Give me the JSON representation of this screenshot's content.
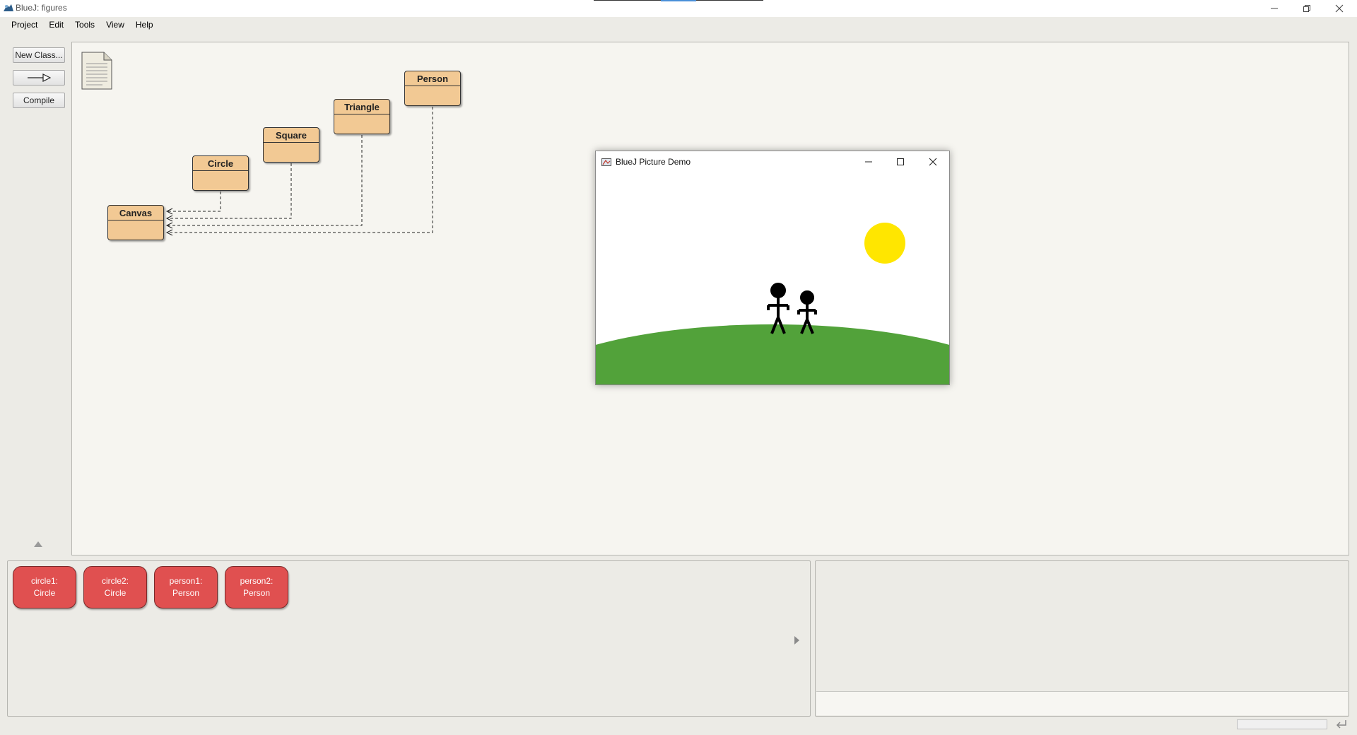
{
  "window": {
    "title": "BlueJ: figures"
  },
  "menu": {
    "items": [
      "Project",
      "Edit",
      "Tools",
      "View",
      "Help"
    ]
  },
  "toolbar": {
    "new_class": "New Class...",
    "compile": "Compile"
  },
  "classes": [
    "Person",
    "Triangle",
    "Square",
    "Circle",
    "Canvas"
  ],
  "demo": {
    "title": "BlueJ Picture Demo",
    "colors": {
      "sun": "#ffe600",
      "grass": "#52a23a",
      "figures": "#000000",
      "sky": "#ffffff"
    }
  },
  "bench": {
    "objects": [
      {
        "name": "circle1:",
        "type": "Circle"
      },
      {
        "name": "circle2:",
        "type": "Circle"
      },
      {
        "name": "person1:",
        "type": "Person"
      },
      {
        "name": "person2:",
        "type": "Person"
      }
    ]
  },
  "colors": {
    "class_fill": "#f2c994",
    "object_fill": "#e05050"
  },
  "icons": {
    "app": "bluej-icon",
    "minimize": "minimize-icon",
    "maximize": "maximize-icon",
    "close": "close-icon",
    "readme": "document-icon",
    "uses_arrow": "arrow-right-icon"
  }
}
